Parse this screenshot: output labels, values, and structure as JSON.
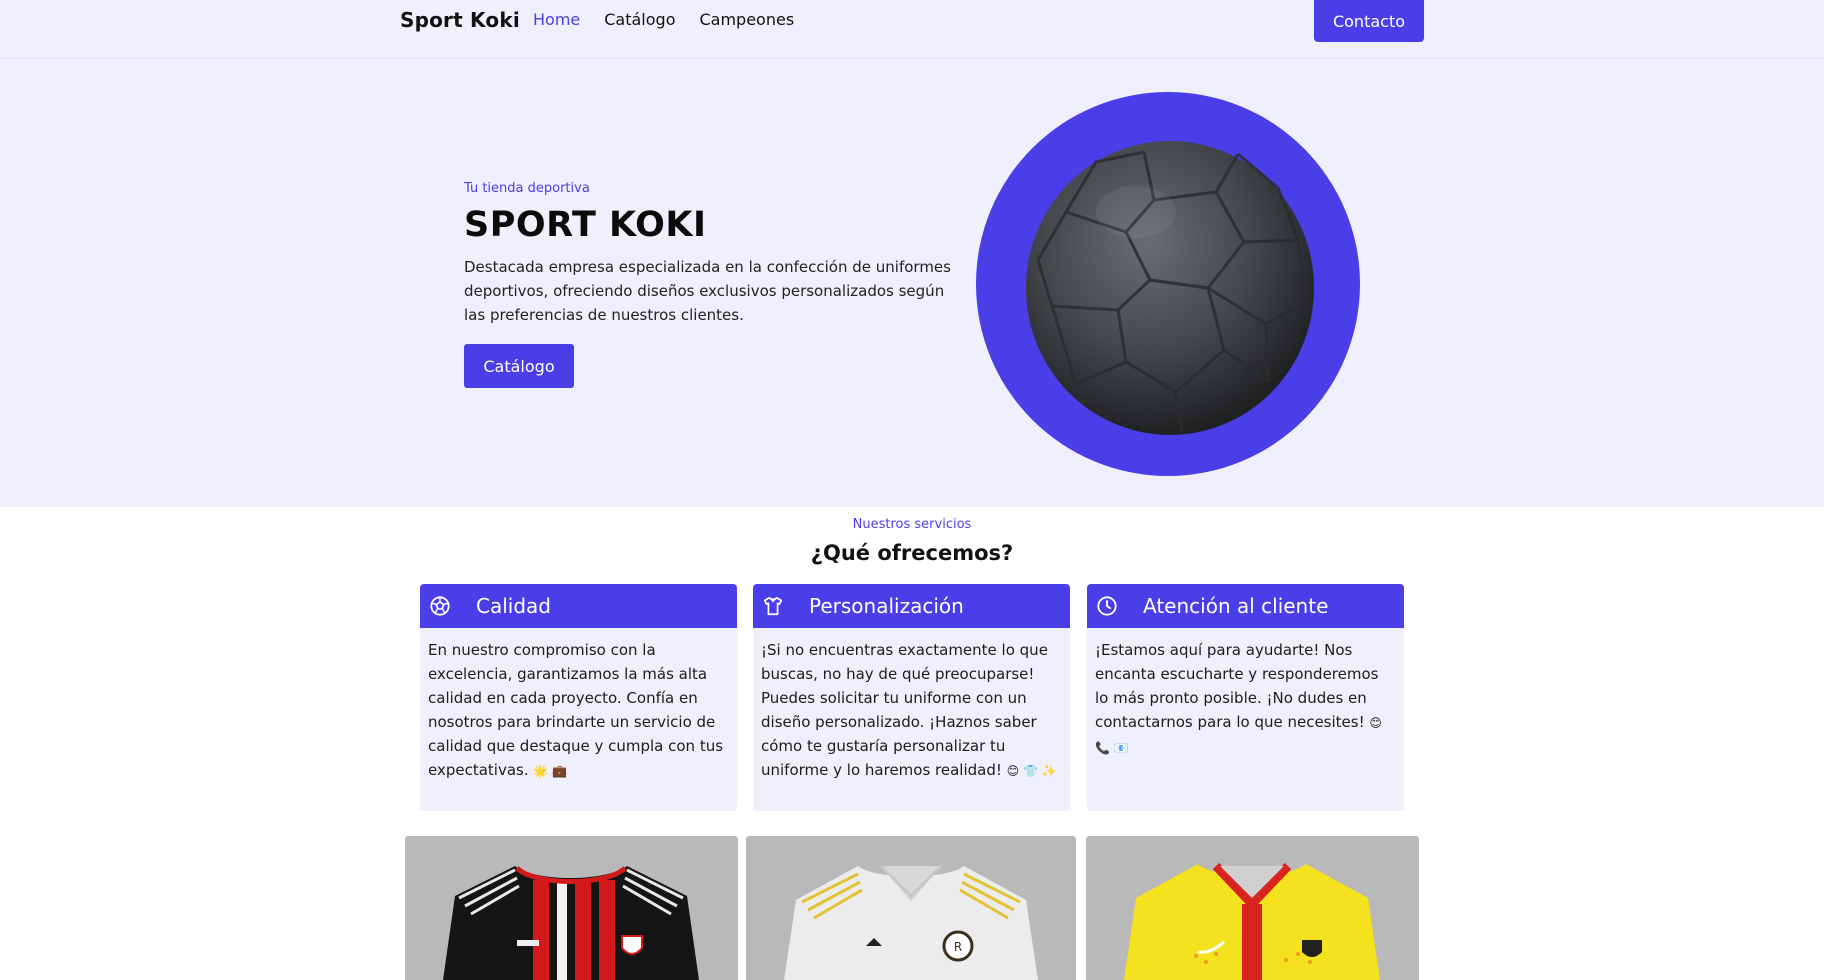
{
  "header": {
    "brand": "Sport Koki",
    "nav": [
      {
        "label": "Home",
        "active": true
      },
      {
        "label": "Catálogo",
        "active": false
      },
      {
        "label": "Campeones",
        "active": false
      }
    ],
    "contact_label": "Contacto"
  },
  "hero": {
    "eyebrow": "Tu tienda deportiva",
    "title": "SPORT KOKI",
    "description": "Destacada empresa especializada en la confección de uniformes deportivos, ofreciendo diseños exclusivos personalizados según las preferencias de nuestros clientes.",
    "button_label": "Catálogo",
    "image_icon": "soccer-ball-image"
  },
  "services": {
    "eyebrow": "Nuestros servicios",
    "title": "¿Qué ofrecemos?",
    "cards": [
      {
        "icon": "soccer-ball-icon",
        "title": "Calidad",
        "text": "En nuestro compromiso con la excelencia, garantizamos la más alta calidad en cada proyecto. Confía en nosotros para brindarte un servicio de calidad que destaque y cumpla con tus expectativas.",
        "emoji": "🌟 💼"
      },
      {
        "icon": "shirt-icon",
        "title": "Personalización",
        "text": "¡Si no encuentras exactamente lo que buscas, no hay de qué preocuparse! Puedes solicitar tu uniforme con un diseño personalizado. ¡Haznos saber cómo te gustaría personalizar tu uniforme y lo haremos realidad!",
        "emoji": "😊 👕 ✨"
      },
      {
        "icon": "clock-icon",
        "title": "Atención al cliente",
        "text": "¡Estamos aquí para ayudarte! Nos encanta escucharte y responderemos lo más pronto posible. ¡No dudes en contactarnos para lo que necesites!",
        "emoji": "😊 📞 📧"
      }
    ]
  },
  "products": [
    {
      "image": "red-black-striped-jersey"
    },
    {
      "image": "white-gold-jersey"
    },
    {
      "image": "yellow-red-jersey"
    }
  ],
  "colors": {
    "accent": "#4a3ee8",
    "hero_bg": "#f0effd",
    "card_bg": "#f0effd"
  }
}
